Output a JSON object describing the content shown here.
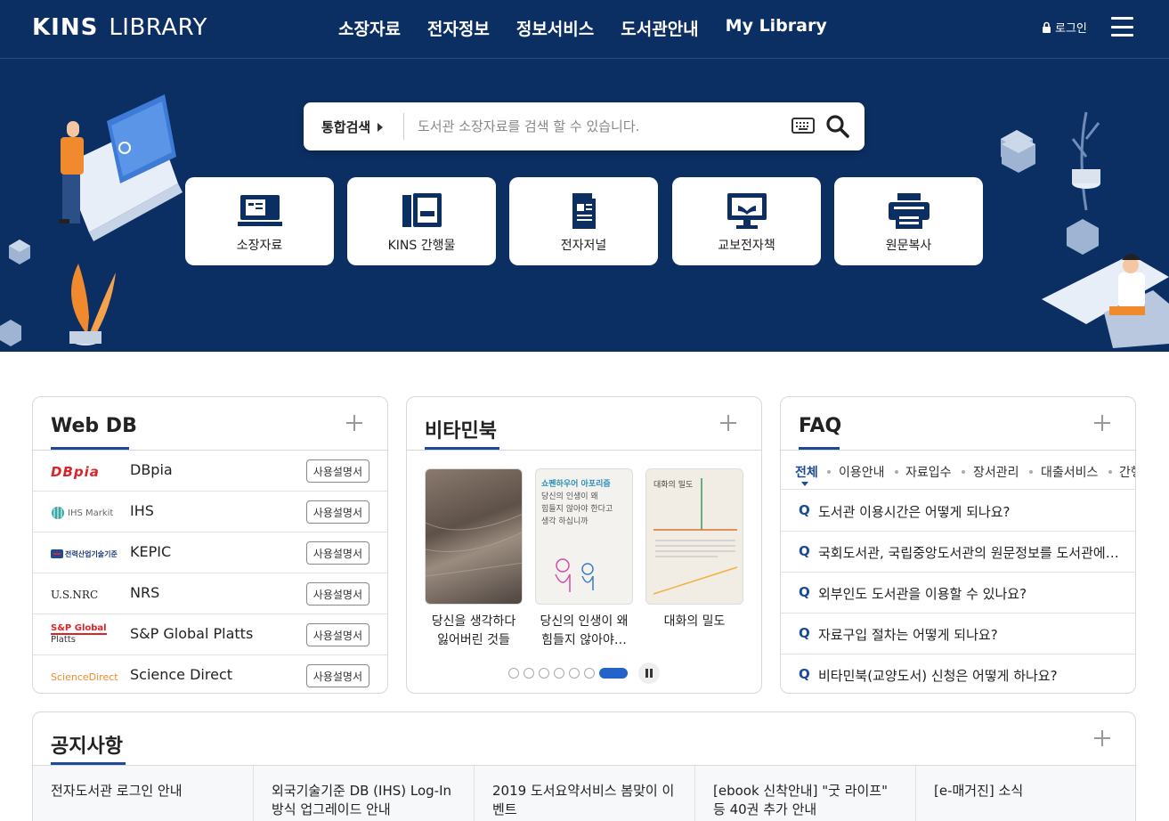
{
  "header": {
    "logo_main": "KINS",
    "logo_sub": "LIBRARY",
    "nav": [
      "소장자료",
      "전자정보",
      "정보서비스",
      "도서관안내",
      "My Library"
    ],
    "login_label": "로그인"
  },
  "search": {
    "scope_label": "통합검색",
    "placeholder": "도서관 소장자료를 검색 할 수 있습니다."
  },
  "quick_links": [
    {
      "label": "소장자료",
      "icon": "book-shelf-icon"
    },
    {
      "label": "KINS 간행물",
      "icon": "kins-publication-icon"
    },
    {
      "label": "전자저널",
      "icon": "e-journal-icon"
    },
    {
      "label": "교보전자책",
      "icon": "monitor-ebook-icon"
    },
    {
      "label": "원문복사",
      "icon": "printer-icon"
    }
  ],
  "webdb": {
    "title": "Web DB",
    "manual_label": "사용설명서",
    "items": [
      {
        "name": "DBpia",
        "logo": "DBpia"
      },
      {
        "name": "IHS",
        "logo": "IHS Markit"
      },
      {
        "name": "KEPIC",
        "logo": "전력산업기술기준"
      },
      {
        "name": "NRS",
        "logo": "U.S.NRC"
      },
      {
        "name": "S&P Global Platts",
        "logo": "S&P Global",
        "logo_sub": "Platts"
      },
      {
        "name": "Science Direct",
        "logo": "ScienceDirect"
      }
    ]
  },
  "vitamin": {
    "title": "비타민북",
    "books": [
      {
        "title_line1": "당신을 생각하다",
        "title_line2": "잃어버린 것들"
      },
      {
        "title_line1": "당신의 인생이 왜",
        "title_line2": "힘들지 않아야…",
        "cover_line1": "쇼펜하우어 아포리즘",
        "cover_line2": "당신의 인생이 왜",
        "cover_line3": "힘들지 않아야 한다고",
        "cover_line4": "생각 하십니까"
      },
      {
        "title_line1": "대화의 밀도",
        "title_line2": "",
        "cover_line1": "대화의 밀도"
      }
    ],
    "slides_total": 7,
    "slides_active": 7
  },
  "faq": {
    "title": "FAQ",
    "q_mark": "Q",
    "tabs": [
      "전체",
      "이용안내",
      "자료입수",
      "장서관리",
      "대출서비스",
      "간행"
    ],
    "items": [
      "도서관 이용시간은 어떻게 되나요?",
      "국회도서관, 국립중앙도서관의 원문정보를 도서관에서 이용할 수 있나요?",
      "외부인도 도서관을 이용할 수 있나요?",
      "자료구입 절차는 어떻게 되나요?",
      "비타민북(교양도서) 신청은 어떻게 하나요?"
    ]
  },
  "notice": {
    "title": "공지사항",
    "items": [
      "전자도서관 로그인 안내",
      "외국기술기준 DB (IHS) Log-In 방식 업그레이드 안내",
      "2019 도서요약서비스 봄맞이 이벤트",
      "[ebook 신착안내] \"굿 라이프\" 등 40권 추가 안내",
      "[e-매거진] 소식"
    ]
  },
  "colors": {
    "navy": "#0c2f63",
    "accent": "#1c4a96",
    "orange": "#f08a2c"
  }
}
